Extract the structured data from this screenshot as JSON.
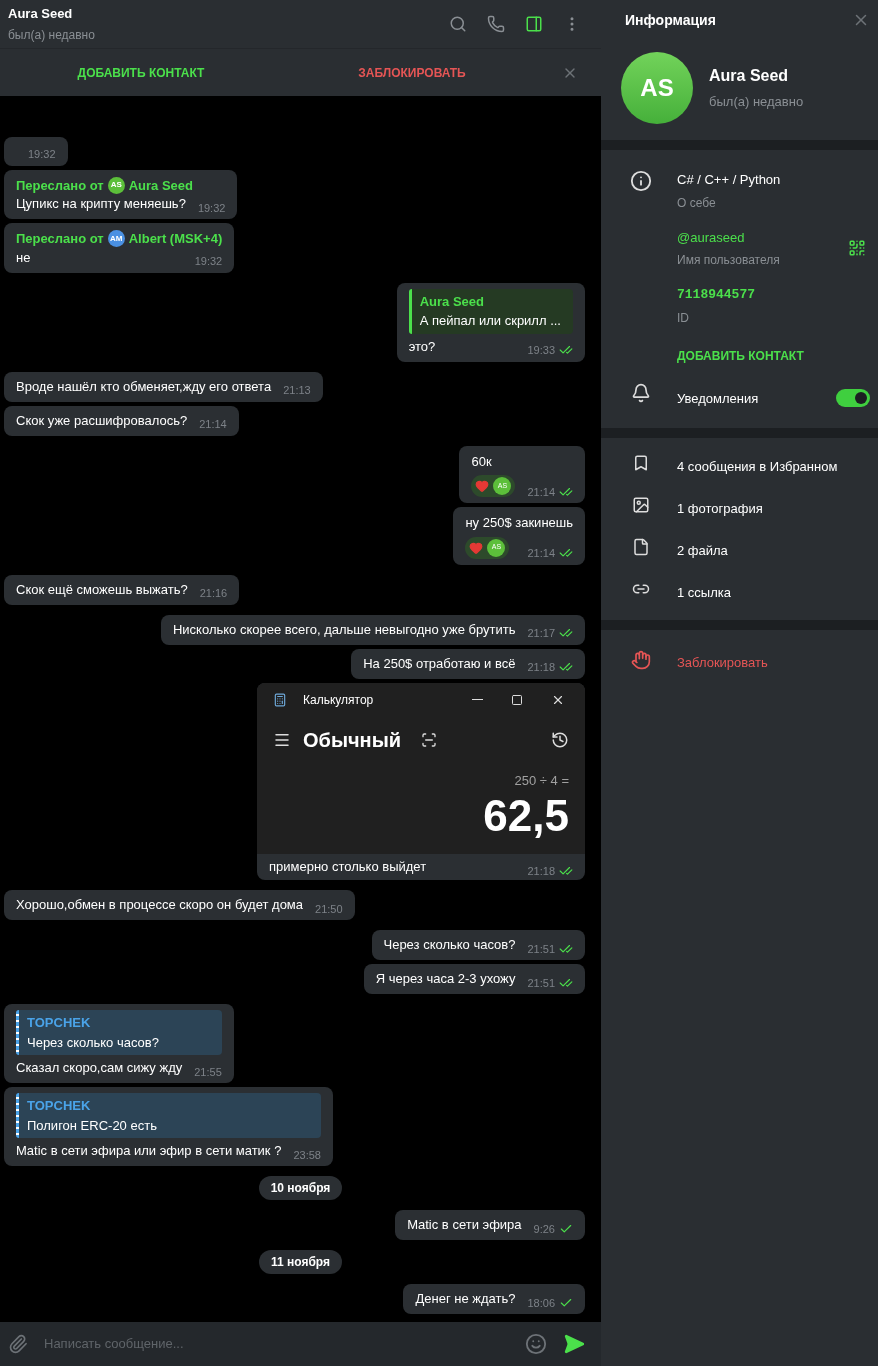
{
  "header": {
    "title": "Aura Seed",
    "status": "был(а) недавно"
  },
  "action_bar": {
    "add_contact": "ДОБАВИТЬ КОНТАКТ",
    "block": "ЗАБЛОКИРОВАТЬ"
  },
  "messages": [
    {
      "kind": "in",
      "time": "19:32"
    },
    {
      "kind": "in",
      "forwarded": {
        "label": "Переслано от",
        "avatar": "AS",
        "color": "#5cbf3a",
        "name": "Aura Seed"
      },
      "text": "Цупикс на крипту меняешь?",
      "time": "19:32"
    },
    {
      "kind": "in",
      "forwarded": {
        "label": "Переслано от",
        "avatar": "AM",
        "color": "#4a90e2",
        "name": "Albert (MSK+4)"
      },
      "text": "не",
      "time": "19:32"
    },
    {
      "kind": "out",
      "reply": {
        "author": "Aura Seed",
        "text": "А пейпал или скрилл ..."
      },
      "text": "это?",
      "time": "19:33",
      "read": true
    },
    {
      "kind": "in",
      "text": "Вроде нашёл кто обменяет,жду его ответа",
      "time": "21:13"
    },
    {
      "kind": "in",
      "text": "Скок уже расшифровалось?",
      "time": "21:14"
    },
    {
      "kind": "out",
      "text": "60к",
      "reactions": [
        {
          "avatar": "AS"
        }
      ],
      "time": "21:14",
      "read": true
    },
    {
      "kind": "out",
      "text": "ну 250$ закинешь",
      "reactions": [
        {
          "avatar": "AS"
        }
      ],
      "time": "21:14",
      "read": true
    },
    {
      "kind": "in",
      "text": "Скок ещё сможешь выжать?",
      "time": "21:16"
    },
    {
      "kind": "out",
      "text": "Нисколько скорее всего, дальше невыгодно уже брутить",
      "time": "21:17",
      "read": true
    },
    {
      "kind": "out",
      "text": "На 250$ отработаю и всё",
      "time": "21:18",
      "read": true
    },
    {
      "kind": "out",
      "screenshot": {
        "title": "Калькулятор",
        "mode": "Обычный",
        "expression": "250 ÷ 4 =",
        "result": "62,5"
      },
      "text": "примерно столько выйдет",
      "time": "21:18",
      "read": true
    },
    {
      "kind": "in",
      "text": "Хорошо,обмен в процессе скоро он будет дома",
      "time": "21:50"
    },
    {
      "kind": "out",
      "text": "Через сколько часов?",
      "time": "21:51",
      "read": true
    },
    {
      "kind": "out",
      "text": "Я через часа 2-3 ухожу",
      "time": "21:51",
      "read": true
    },
    {
      "kind": "in",
      "reply": {
        "author": "TOPCHEK",
        "text": "Через сколько часов?"
      },
      "text": "Сказал скоро,сам сижу жду",
      "time": "21:55"
    },
    {
      "kind": "in",
      "reply": {
        "author": "TOPCHEK",
        "text": "Полигон ERC-20 есть"
      },
      "text": "Matic в сети эфира или эфир в сети матик ?",
      "time": "23:58"
    },
    {
      "kind": "date",
      "text": "10 ноября"
    },
    {
      "kind": "out",
      "text": "Matic в сети эфира",
      "time": "9:26",
      "read": false
    },
    {
      "kind": "date",
      "text": "11 ноября"
    },
    {
      "kind": "out",
      "text": "Денег не ждать?",
      "time": "18:06",
      "read": false
    }
  ],
  "composer": {
    "placeholder": "Написать сообщение..."
  },
  "info_panel": {
    "title": "Информация",
    "profile": {
      "initials": "AS",
      "name": "Aura Seed",
      "status": "был(а) недавно"
    },
    "bio": {
      "value": "C# / C++ / Python",
      "label": "О себе"
    },
    "username": {
      "value": "@auraseed",
      "label": "Имя пользователя"
    },
    "id": {
      "value": "7118944577",
      "label": "ID"
    },
    "add_contact": "ДОБАВИТЬ КОНТАКТ",
    "notifications": {
      "label": "Уведомления",
      "on": true
    },
    "media": [
      {
        "kind": "saved",
        "label": "4 сообщения в Избранном"
      },
      {
        "kind": "photo",
        "label": "1 фотография"
      },
      {
        "kind": "file",
        "label": "2 файла"
      },
      {
        "kind": "link",
        "label": "1 ссылка"
      }
    ],
    "block": "Заблокировать"
  }
}
